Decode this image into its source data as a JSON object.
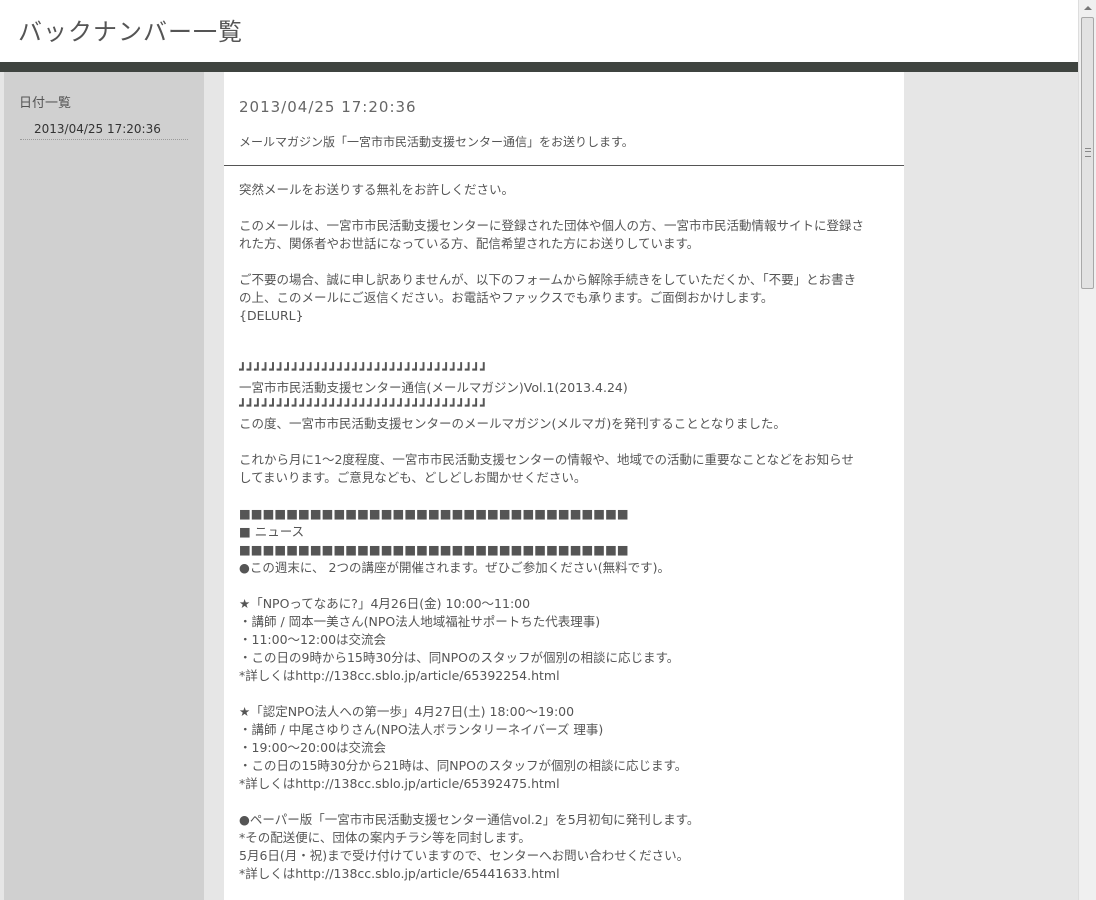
{
  "header": {
    "title": "バックナンバー一覧"
  },
  "sidebar": {
    "title": "日付一覧",
    "items": [
      {
        "label": "2013/04/25 17:20:36"
      }
    ]
  },
  "post": {
    "date": "2013/04/25 17:20:36",
    "subtitle": "メールマガジン版「一宮市市民活動支援センター通信」をお送りします。",
    "body": {
      "intro": "突然メールをお送りする無礼をお許しください。",
      "p2_l1": "このメールは、一宮市市民活動支援センターに登録された団体や個人の方、一宮市市民活動情報サイトに登録さ",
      "p2_l2": "れた方、関係者やお世話になっている方、配信希望された方にお送りしています。",
      "p3_l1": "ご不要の場合、誠に申し訳ありませんが、以下のフォームから解除手続きをしていただくか、「不要」とお書き",
      "p3_l2": "の上、このメールにご返信ください。お電話やファックスでも承ります。ご面倒おかけします。",
      "delurl": "{DELURL}",
      "deco_line": "┛┛┛┛┛┛┛┛┛┛┛┛┛┛┛┛┛┛┛┛┛┛┛┛┛┛┛┛┛┛┛┛┛",
      "mag_title": "一宮市市民活動支援センター通信(メールマガジン)Vol.1(2013.4.24)",
      "announce": "この度、一宮市市民活動支援センターのメールマガジン(メルマガ)を発刊することとなりました。",
      "p5_l1": "これから月に1～2度程度、一宮市市民活動支援センターの情報や、地域での活動に重要なことなどをお知らせ",
      "p5_l2": "してまいります。ご意見なども、どしどしお聞かせください。",
      "square_line": "■■■■■■■■■■■■■■■■■■■■■■■■■■■■■■■■■",
      "news_heading": "■ ニュース",
      "news_lead": "●この週末に、 2つの講座が開催されます。ぜひご参加ください(無料です)。",
      "e1_title": "★「NPOってなあに?」4月26日(金) 10:00～11:00",
      "e1_l1": "・講師 / 岡本一美さん(NPO法人地域福祉サポートちた代表理事)",
      "e1_l2": "・11:00～12:00は交流会",
      "e1_l3": "・この日の9時から15時30分は、同NPOのスタッフが個別の相談に応じます。",
      "e1_l4": "*詳しくはhttp://138cc.sblo.jp/article/65392254.html",
      "e2_title": "★「認定NPO法人への第一歩」4月27日(土) 18:00～19:00",
      "e2_l1": "・講師 / 中尾さゆりさん(NPO法人ボランタリーネイバーズ 理事)",
      "e2_l2": "・19:00～20:00は交流会",
      "e2_l3": "・この日の15時30分から21時は、同NPOのスタッフが個別の相談に応じます。",
      "e2_l4": "*詳しくはhttp://138cc.sblo.jp/article/65392475.html",
      "paper_l1": "●ペーパー版「一宮市市民活動支援センター通信vol.2」を5月初旬に発刊します。",
      "paper_l2": "*その配送便に、団体の案内チラシ等を同封します。",
      "paper_l3": "5月6日(月・祝)まで受け付けていますので、センターへお問い合わせください。",
      "paper_l4": "*詳しくはhttp://138cc.sblo.jp/article/65441633.html"
    }
  }
}
